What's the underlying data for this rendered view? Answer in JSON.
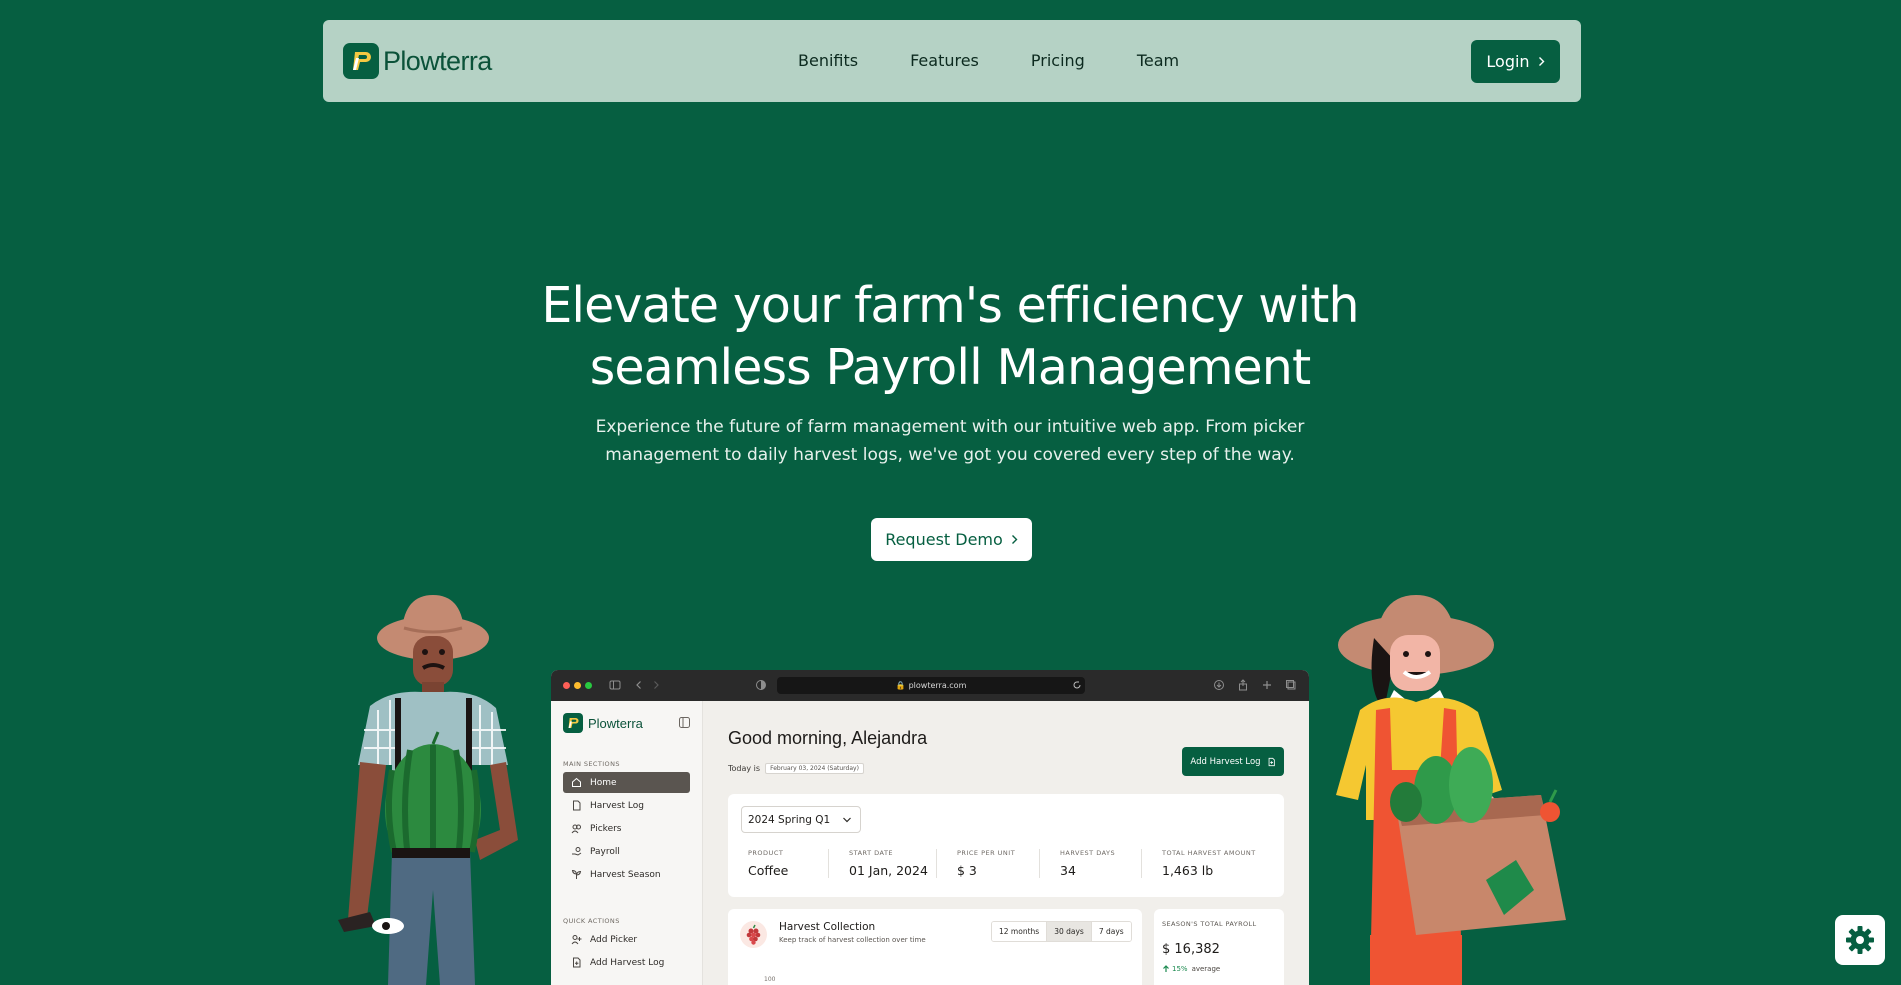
{
  "nav": {
    "brand": "Plowterra",
    "links": [
      "Benifits",
      "Features",
      "Pricing",
      "Team"
    ],
    "login_label": "Login"
  },
  "hero": {
    "title_line1": "Elevate your farm's efficiency with",
    "title_line2": "seamless Payroll Management",
    "subtitle_line1": "Experience the future of farm management with our intuitive web app. From picker",
    "subtitle_line2": "management to daily harvest logs, we've got you covered every step of the way.",
    "cta_label": "Request Demo"
  },
  "mockup": {
    "url": "plowterra.com",
    "sidebar": {
      "brand": "Plowterra",
      "main_sections_label": "MAIN SECTIONS",
      "main_items": [
        "Home",
        "Harvest Log",
        "Pickers",
        "Payroll",
        "Harvest Season"
      ],
      "active_item": "Home",
      "quick_actions_label": "QUICK ACTIONS",
      "quick_items": [
        "Add Picker",
        "Add Harvest Log"
      ]
    },
    "main": {
      "greeting": "Good morning, Alejandra",
      "today_label": "Today is",
      "today_date": "February 03, 2024 (Saturday)",
      "add_log_label": "Add Harvest Log",
      "season_select": "2024 Spring Q1",
      "stats": [
        {
          "label": "PRODUCT",
          "value": "Coffee"
        },
        {
          "label": "START DATE",
          "value": "01 Jan, 2024"
        },
        {
          "label": "PRICE PER UNIT",
          "value": "$ 3"
        },
        {
          "label": "HARVEST DAYS",
          "value": "34"
        },
        {
          "label": "TOTAL HARVEST AMOUNT",
          "value": "1,463 lb"
        }
      ],
      "harvest": {
        "title": "Harvest Collection",
        "subtitle": "Keep track of harvest collection over time",
        "tabs": [
          "12 months",
          "30 days",
          "7 days"
        ],
        "active_tab": "30 days",
        "axis_top": "100"
      },
      "payroll": {
        "label": "SEASON'S TOTAL PAYROLL",
        "value": "$ 16,382",
        "trend_pct": "15%",
        "trend_label": "average"
      }
    }
  },
  "colors": {
    "background": "#065f41",
    "navbar": "#b5d2c5",
    "accent": "#065f41",
    "trend_up": "#1b8a4f"
  }
}
